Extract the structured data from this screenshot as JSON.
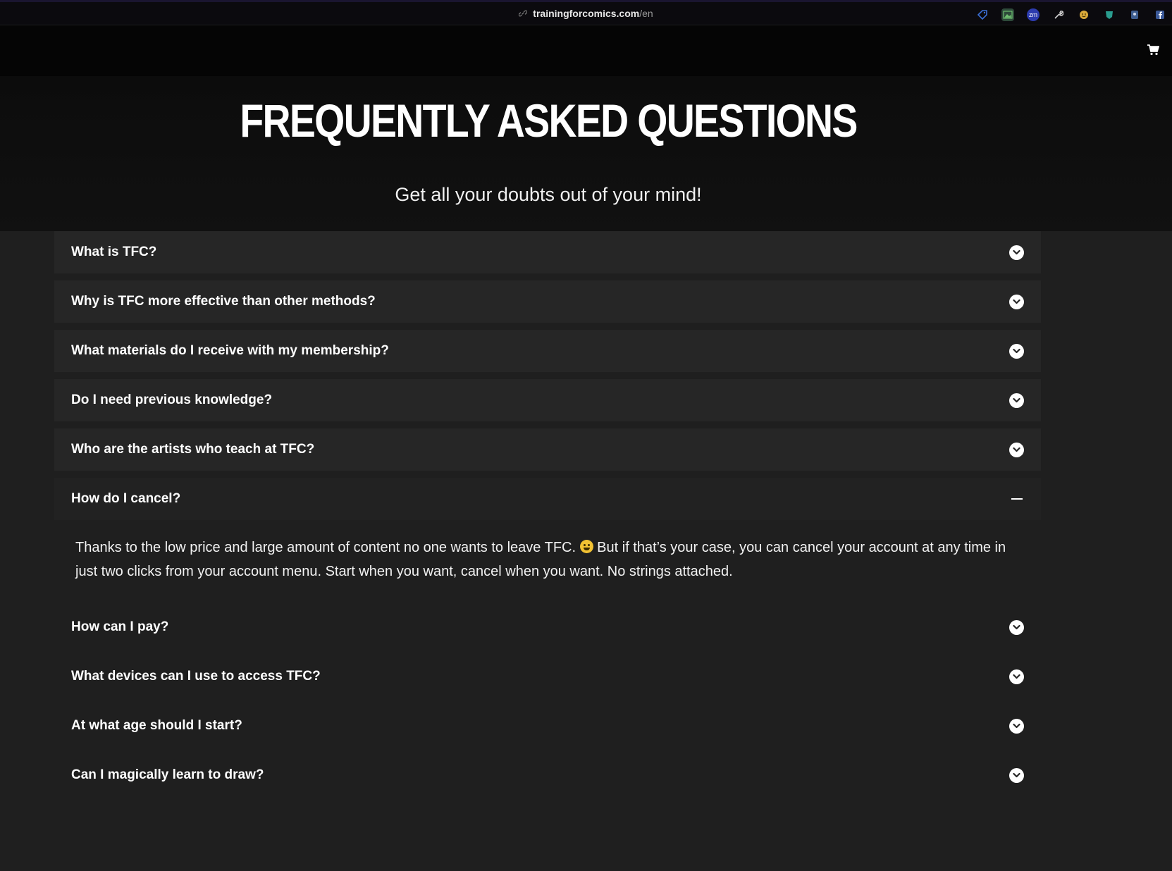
{
  "browser": {
    "url_domain": "trainingforcomics.com",
    "url_path": "/en",
    "extensions": [
      "tag-icon",
      "image-icon",
      "zm-icon",
      "wrench-icon",
      "emoji-icon",
      "shield-icon",
      "user-icon",
      "facebook-icon"
    ]
  },
  "header": {
    "cart_icon": "shopping-cart-icon"
  },
  "hero": {
    "title": "FREQUENTLY ASKED QUESTIONS",
    "subtitle": "Get all your doubts out of your mind!"
  },
  "faq": {
    "items": [
      {
        "question": "What is TFC?",
        "open": false
      },
      {
        "question": "Why is TFC more effective than other methods?",
        "open": false
      },
      {
        "question": "What materials do I receive with my membership?",
        "open": false
      },
      {
        "question": "Do I need previous knowledge?",
        "open": false
      },
      {
        "question": "Who are the artists who teach at TFC?",
        "open": false
      },
      {
        "question": "How do I cancel?",
        "open": true,
        "answer_part1": "Thanks to the low price and large amount of content no one wants to leave TFC.",
        "answer_part2": "But if that’s your case, you can cancel your account at any time in just two clicks from your account menu. Start when you want, cancel when you want. No strings attached."
      },
      {
        "question": "How can I pay?",
        "open": false
      },
      {
        "question": "What devices can I use to access TFC?",
        "open": false
      },
      {
        "question": "At what age should I start?",
        "open": false
      },
      {
        "question": "Can I magically learn to draw?",
        "open": false
      }
    ]
  },
  "colors": {
    "page_bg": "#1f1f1f",
    "item_bg": "#262626",
    "header_bg": "#050505"
  }
}
